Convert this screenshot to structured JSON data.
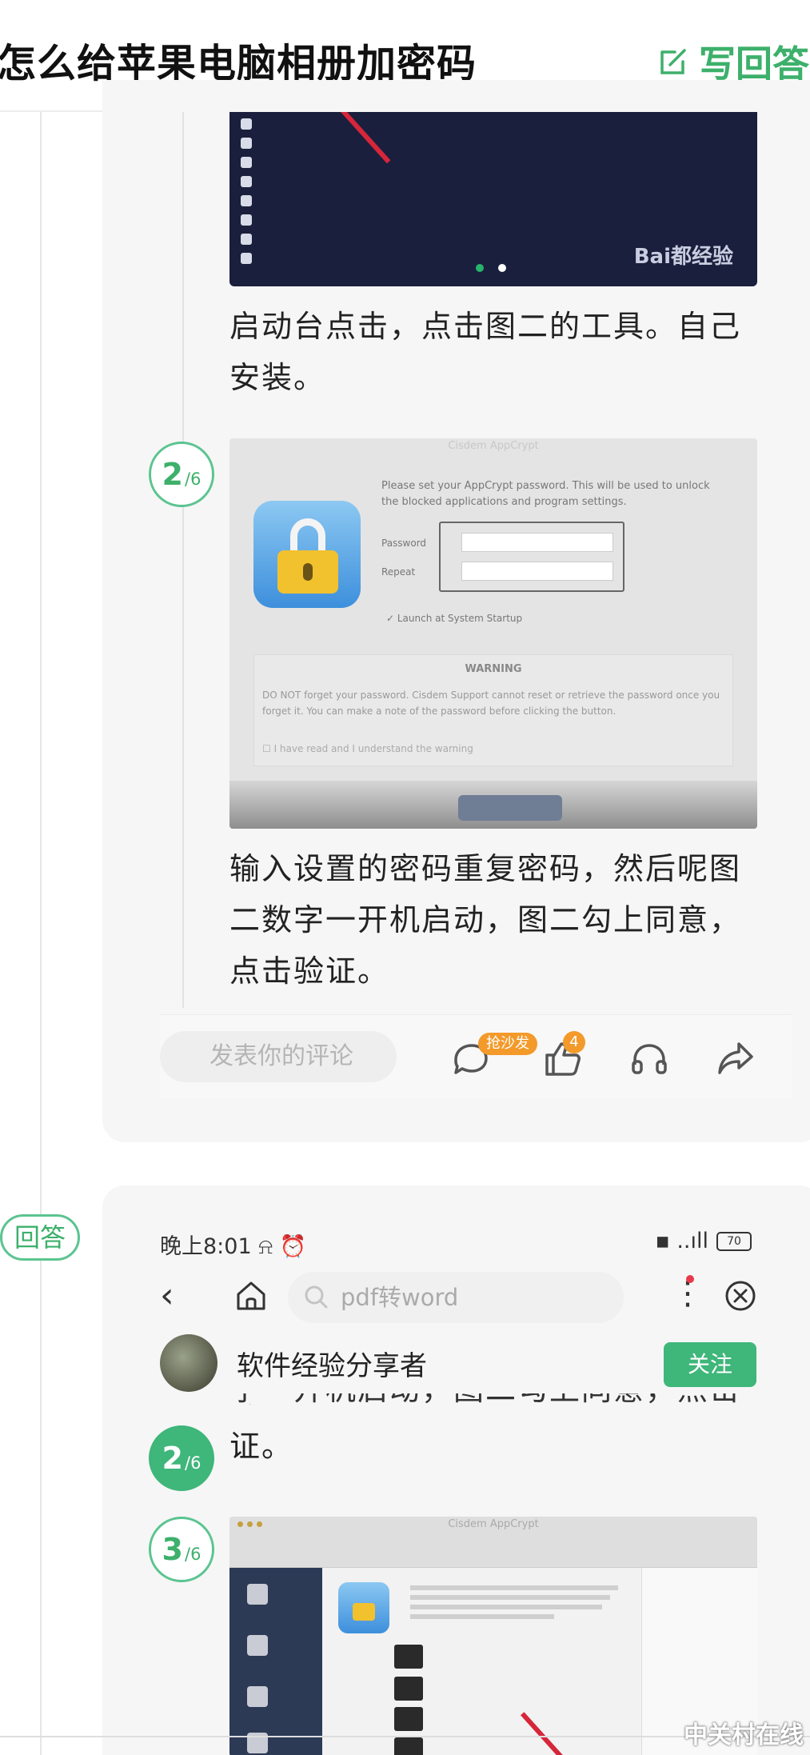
{
  "header": {
    "title": "怎么给苹果电脑相册加密码",
    "write_answer_label": "写回答"
  },
  "answer1": {
    "step1_text": "启动台点击，点击图二的工具。自己安装。",
    "step2": {
      "number": "2",
      "total": "/6"
    },
    "step2_text": "输入设置的密码重复密码，然后呢图二数字一开机启动，图二勾上同意，点击验证。",
    "image1": {
      "watermark": "Bai都经验"
    },
    "image2": {
      "caption": "Cisdem AppCrypt",
      "description": "Please set your AppCrypt password. This will be used to unlock the blocked applications and program settings.",
      "password_label": "Password",
      "repeat_label": "Repeat",
      "launch_label": "Launch at System Startup",
      "warning_title": "WARNING",
      "warning_text": "DO NOT forget your password. Cisdem Support cannot reset or retrieve the password once you forget it. You can make a note of the password before clicking the button.",
      "agree_label": "I have read and I understand the warning"
    },
    "comment": {
      "placeholder": "发表你的评论",
      "comment_badge": "抢沙发",
      "like_count": "4"
    }
  },
  "answer_tag": "回答",
  "answer2": {
    "status": {
      "time": "晚上8:01",
      "battery": "70"
    },
    "search_text": "pdf转word",
    "author": "软件经验分享者",
    "follow_label": "关注",
    "cut_text": "字一开机启动，图二勾上同意，点击验",
    "step2": {
      "number": "2",
      "total": "/6"
    },
    "step2_text": "证。",
    "step3": {
      "number": "3",
      "total": "/6"
    },
    "image3": {
      "caption": "Cisdem AppCrypt"
    }
  },
  "watermark": "中关村在线",
  "colors": {
    "accent": "#3db06b",
    "badge": "#f39a2a",
    "card_bg": "#f6f6f6"
  }
}
